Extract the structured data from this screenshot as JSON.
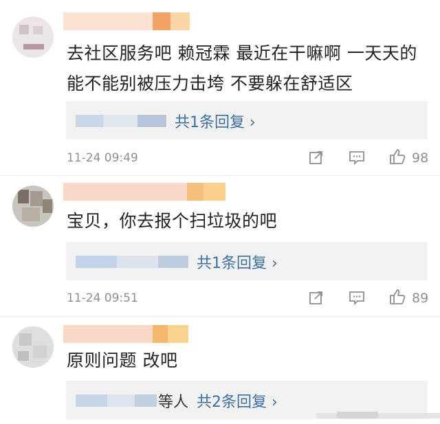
{
  "comments": [
    {
      "text": "去社区服务吧 赖冠霖 最近在干嘛啊 一天天的 能不能别被压力击垮 不要躲在舒适区",
      "reply_link": "共1条回复 ›",
      "reply_suffix": "",
      "time": "11-24 09:49",
      "likes": "98"
    },
    {
      "text": "宝贝，你去报个扫垃圾的吧",
      "reply_link": "共1条回复 ›",
      "reply_suffix": "",
      "time": "11-24 09:51",
      "likes": "89"
    },
    {
      "text": "原则问题 改吧",
      "reply_link": "共2条回复 ›",
      "reply_suffix": "等人",
      "time": "",
      "likes": ""
    }
  ],
  "icons": {
    "share": "share-icon",
    "comment": "comment-icon",
    "like": "thumbs-up-icon"
  },
  "colors": {
    "link": "#3d6fa5",
    "meta": "#8f8f8f",
    "reply_bg": "#f2f2f2"
  }
}
